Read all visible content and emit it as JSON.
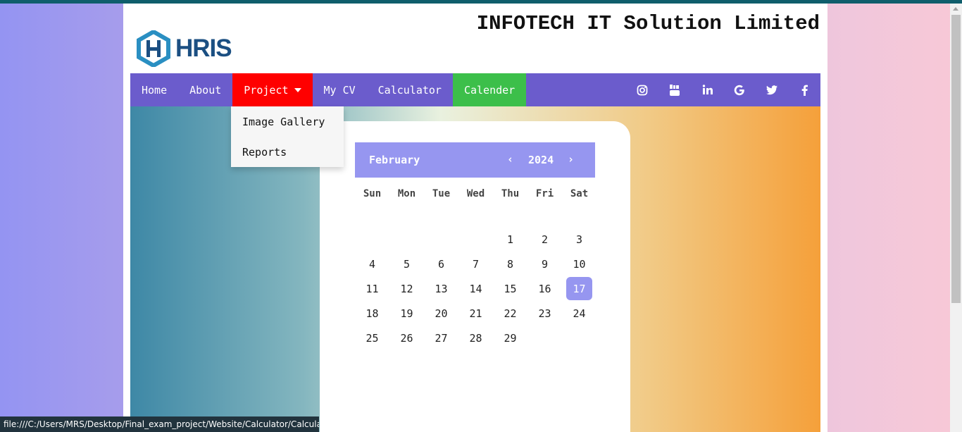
{
  "header": {
    "company": "INFOTECH IT Solution Limited",
    "logo_text": "HRIS"
  },
  "nav": {
    "items": [
      {
        "label": "Home"
      },
      {
        "label": "About"
      },
      {
        "label": "Project"
      },
      {
        "label": "My CV"
      },
      {
        "label": "Calculator"
      },
      {
        "label": "Calender"
      }
    ],
    "social_icons": [
      "instagram-icon",
      "youtube-icon",
      "linkedin-icon",
      "google-icon",
      "twitter-icon",
      "facebook-icon"
    ],
    "colors": {
      "bar": "#6b5ccc",
      "project_active": "#ff0000",
      "calendar_active": "#3cbf4a"
    }
  },
  "dropdown": {
    "items": [
      "Image Gallery",
      "Reports"
    ]
  },
  "calendar": {
    "month": "February",
    "year": "2024",
    "prev": "‹",
    "next": "›",
    "weekdays": [
      "Sun",
      "Mon",
      "Tue",
      "Wed",
      "Thu",
      "Fri",
      "Sat"
    ],
    "days": [
      "",
      "",
      "",
      "",
      "1",
      "2",
      "3",
      "4",
      "5",
      "6",
      "7",
      "8",
      "9",
      "10",
      "11",
      "12",
      "13",
      "14",
      "15",
      "16",
      "17",
      "18",
      "19",
      "20",
      "21",
      "22",
      "23",
      "24",
      "25",
      "26",
      "27",
      "28",
      "29"
    ],
    "today": "17",
    "accent": "#9696f0"
  },
  "statusbar": {
    "url": "file:///C:/Users/MRS/Desktop/Final_exam_project/Website/Calculator/Calculator.ht..."
  }
}
